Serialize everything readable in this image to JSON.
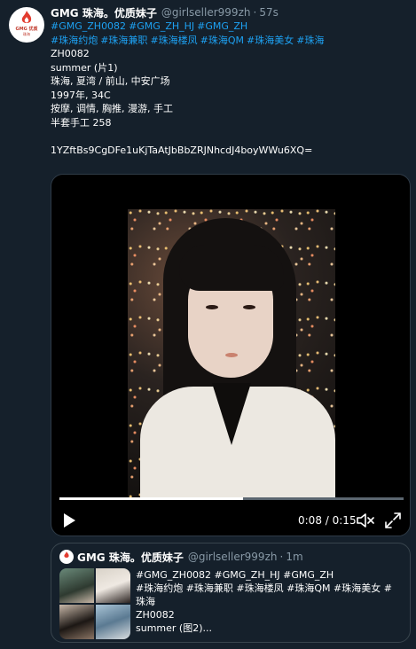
{
  "tweet": {
    "author_name": "GMG 珠海。优质妹子",
    "handle": "@girlseller999zh",
    "separator": "·",
    "time": "57s",
    "avatar_text_top": "GMG 优质",
    "avatar_text_bottom": "珠海",
    "hashtags_line1": [
      "#GMG_ZH0082",
      "#GMG_ZH_HJ",
      "#GMG_ZH"
    ],
    "hashtags_line2": [
      "#珠海约炮",
      "#珠海兼职",
      "#珠海楼凤",
      "#珠海QM",
      "#珠海美女",
      "#珠海"
    ],
    "lines": [
      "ZH0082",
      "summer (片1)",
      "珠海, 夏湾 / 前山, 中安广场",
      "1997年, 34C",
      "按摩, 调情, 胸推, 漫游, 手工",
      "半套手工 258",
      "",
      "1YZftBs9CgDFe1uKjTaAtJbBbZRJNhcdJ4boyWWu6XQ="
    ]
  },
  "video": {
    "current_time": "0:08",
    "duration": "0:15",
    "time_sep": " / ",
    "progress": 0.533,
    "play_icon": "play-icon",
    "volume_icon": "volume-muted-icon",
    "fullscreen_icon": "fullscreen-icon"
  },
  "quote": {
    "author_name": "GMG 珠海。优质妹子",
    "handle": "@girlseller999zh",
    "separator": "·",
    "time": "1m",
    "text_lines": [
      "#GMG_ZH0082 #GMG_ZH_HJ  #GMG_ZH",
      "#珠海约炮 #珠海兼职 #珠海楼凤 #珠海QM #珠海美女 #",
      "珠海",
      "ZH0082",
      "summer (图2)..."
    ]
  },
  "colors": {
    "background": "#15202b",
    "link": "#1da1f2",
    "muted": "#8899a6",
    "border": "#38444d"
  }
}
